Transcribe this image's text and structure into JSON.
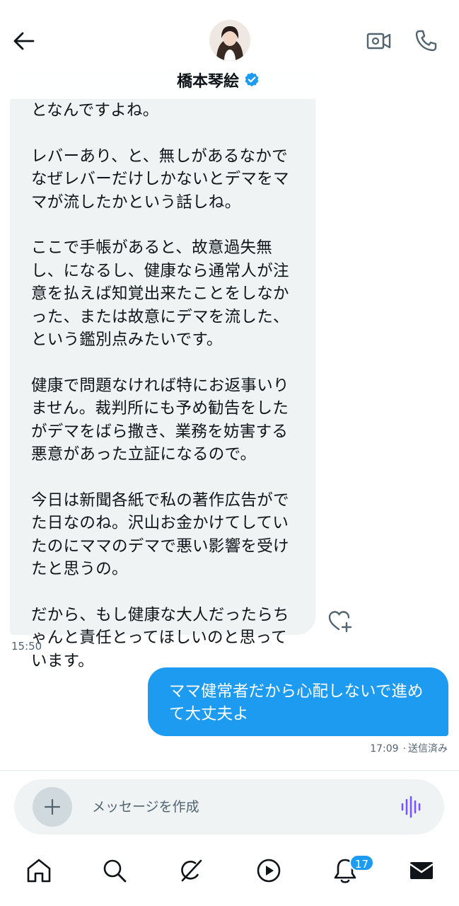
{
  "header": {
    "contact_name": "橋本琴絵",
    "verified": true
  },
  "messages": {
    "incoming": {
      "paragraphs": [
        "となんですよね。",
        "レバーあり、と、無しがあるなかで\nなぜレバーだけしかないとデマをマ\nマが流したかという話しね。",
        "ここで手帳があると、故意過失無\nし、になるし、健康なら通常人が注\n意を払えば知覚出来たことをしなか\nった、または故意にデマを流した、\nという鑑別点みたいです。",
        "健康で問題なければ特にお返事いり\nません。裁判所にも予め勧告をした\nがデマをばら撒き、業務を妨害する\n悪意があった立証になるので。",
        "今日は新聞各紙で私の著作広告がで\nた日なのね。沢山お金かけてしてい\nたのにママのデマで悪い影響を受け\nたと思うの。",
        "だから、もし健康な大人だったらち\nゃんと責任とってほしいのと思って\nいます。"
      ],
      "time": "15:50"
    },
    "outgoing": {
      "text": "ママ健常者だから心配しないで進め\nて大丈夫よ",
      "time": "17:09",
      "status": "送信済み"
    }
  },
  "composer": {
    "placeholder": "メッセージを作成"
  },
  "nav": {
    "notifications_badge": "17"
  },
  "colors": {
    "accent": "#1d9bf0",
    "bubble_in": "#eff3f4",
    "text": "#0f1419",
    "muted": "#536471",
    "voice": "#7856ff"
  },
  "icons": [
    "back-arrow-icon",
    "video-call-icon",
    "phone-icon",
    "verified-badge-icon",
    "heart-plus-icon",
    "plus-icon",
    "voice-wave-icon",
    "home-icon",
    "search-icon",
    "grok-icon",
    "play-icon",
    "bell-icon",
    "mail-icon"
  ]
}
